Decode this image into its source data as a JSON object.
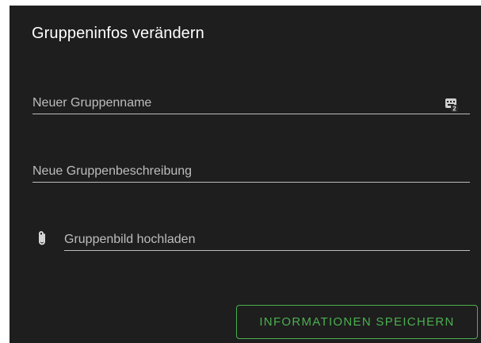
{
  "dialog": {
    "title": "Gruppeninfos verändern",
    "fields": {
      "group_name": {
        "placeholder": "Neuer Gruppenname",
        "value": "",
        "icon": "keyboard-badge-icon",
        "badge": "2"
      },
      "group_description": {
        "placeholder": "Neue Gruppenbeschreibung",
        "value": ""
      },
      "group_image": {
        "placeholder": "Gruppenbild hochladen",
        "value": "",
        "icon": "paperclip-icon"
      }
    },
    "save_button_label": "INFORMATIONEN SPEICHERN"
  },
  "colors": {
    "dialog_background": "#1e1e1e",
    "title_text": "#ffffff",
    "placeholder_text": "#bdbdbd",
    "underline": "#bdbdbd",
    "accent_green": "#4caf50"
  }
}
